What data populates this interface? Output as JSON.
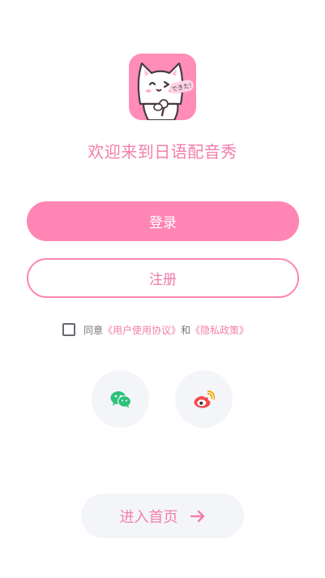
{
  "app": {
    "logo_badge_text": "できた!",
    "welcome_text": "欢迎来到日语配音秀"
  },
  "buttons": {
    "login_label": "登录",
    "register_label": "注册",
    "enter_home_label": "进入首页"
  },
  "agreement": {
    "prefix": "同意",
    "user_agreement_link": "《用户使用协议》",
    "conjunction": "和",
    "privacy_policy_link": "《隐私政策》",
    "checked": false
  },
  "social_login": [
    {
      "name": "wechat",
      "icon": "wechat-icon",
      "color": "#2bc27a"
    },
    {
      "name": "weibo",
      "icon": "weibo-icon",
      "color": "#f24a4a"
    }
  ],
  "colors": {
    "accent": "#ff86b4",
    "accent_text": "#f47eab",
    "soft_background": "#f4f5f8"
  }
}
